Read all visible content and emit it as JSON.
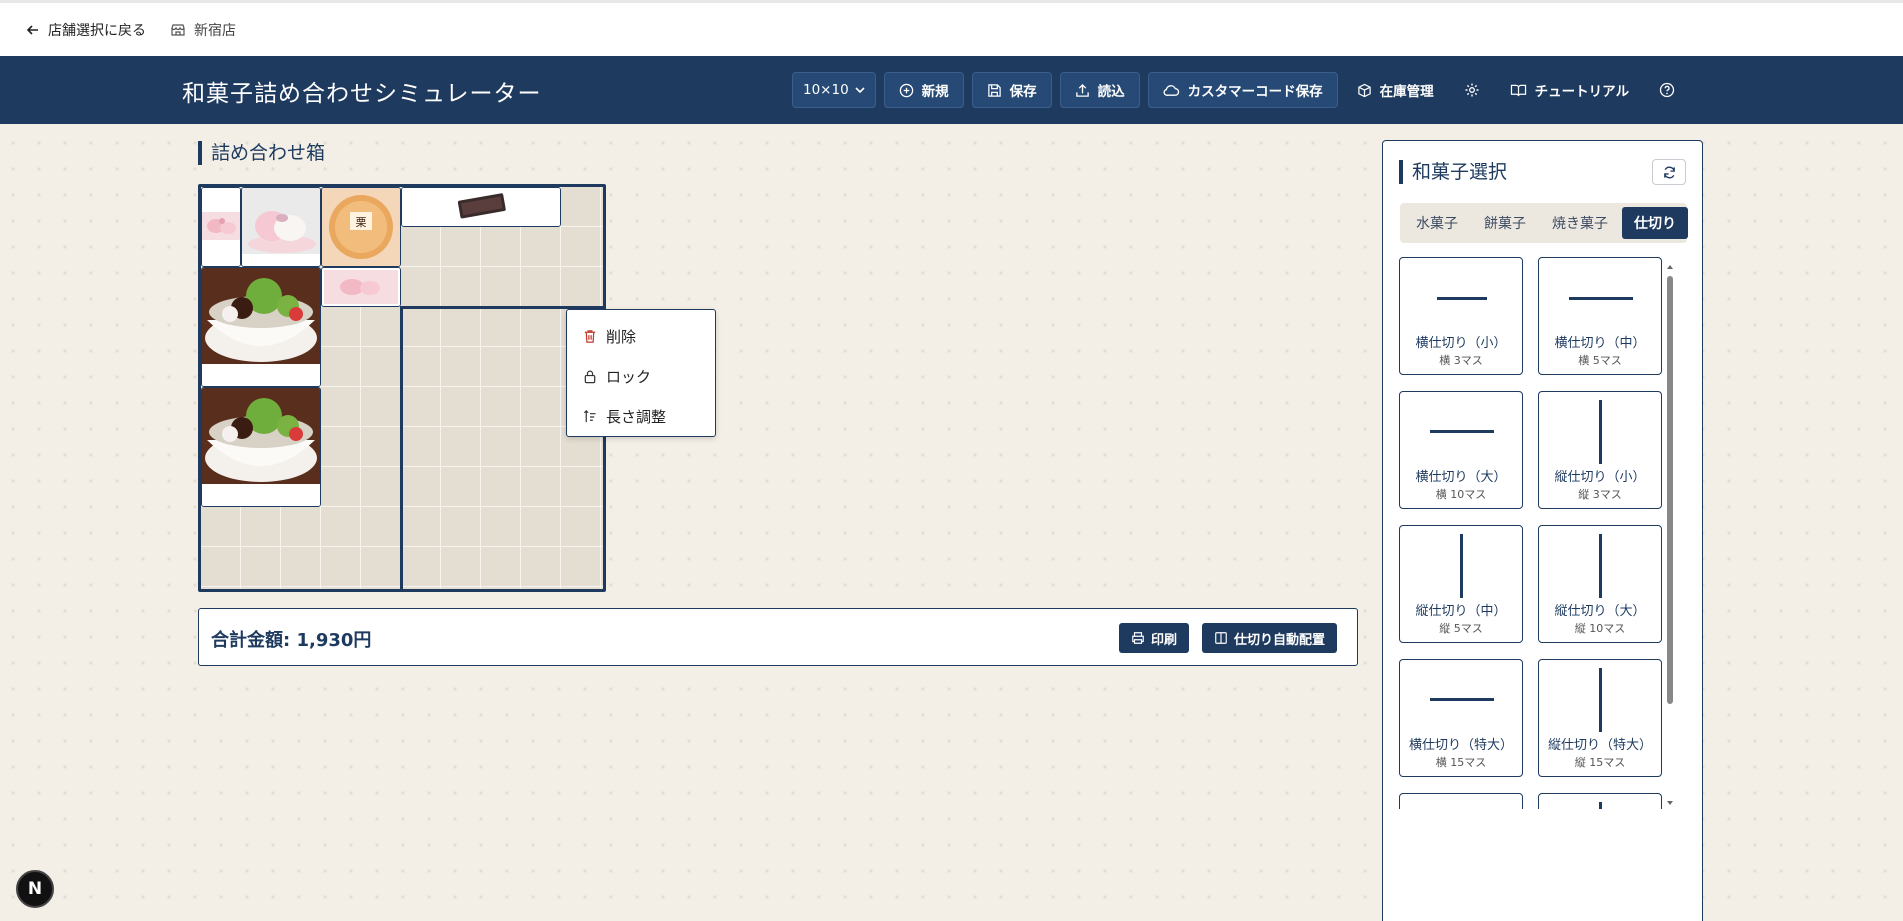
{
  "topbar": {
    "back_label": "店舗選択に戻る",
    "store_name": "新宿店"
  },
  "header": {
    "title": "和菓子詰め合わせシミュレーター",
    "grid_size": "10×10",
    "new_label": "新規",
    "save_label": "保存",
    "load_label": "読込",
    "customer_save_label": "カスタマーコード保存",
    "inventory_label": "在庫管理",
    "tutorial_label": "チュートリアル"
  },
  "box_section": {
    "title": "詰め合わせ箱"
  },
  "context_menu": {
    "items": [
      "削除",
      "ロック",
      "長さ調整"
    ]
  },
  "total": {
    "label": "合計金額: 1,930円",
    "print_label": "印刷",
    "auto_divider_label": "仕切り自動配置"
  },
  "panel": {
    "title": "和菓子選択",
    "tabs": [
      "水菓子",
      "餅菓子",
      "焼き菓子",
      "仕切り"
    ],
    "active_tab": "仕切り",
    "cards": [
      {
        "name": "横仕切り（小）",
        "size": "横 3マス",
        "orientation": "horizontal"
      },
      {
        "name": "横仕切り（中）",
        "size": "横 5マス",
        "orientation": "horizontal"
      },
      {
        "name": "横仕切り（大）",
        "size": "横 10マス",
        "orientation": "horizontal"
      },
      {
        "name": "縦仕切り（小）",
        "size": "縦 3マス",
        "orientation": "vertical"
      },
      {
        "name": "縦仕切り（中）",
        "size": "縦 5マス",
        "orientation": "vertical"
      },
      {
        "name": "縦仕切り（大）",
        "size": "縦 10マス",
        "orientation": "vertical"
      },
      {
        "name": "横仕切り（特大）",
        "size": "横 15マス",
        "orientation": "horizontal"
      },
      {
        "name": "縦仕切り（特大）",
        "size": "縦 15マス",
        "orientation": "vertical"
      }
    ]
  },
  "badge": {
    "letter": "N"
  },
  "colors": {
    "navy": "#1e3a5f",
    "background": "#f3efe6",
    "delete_red": "#c0392b"
  }
}
